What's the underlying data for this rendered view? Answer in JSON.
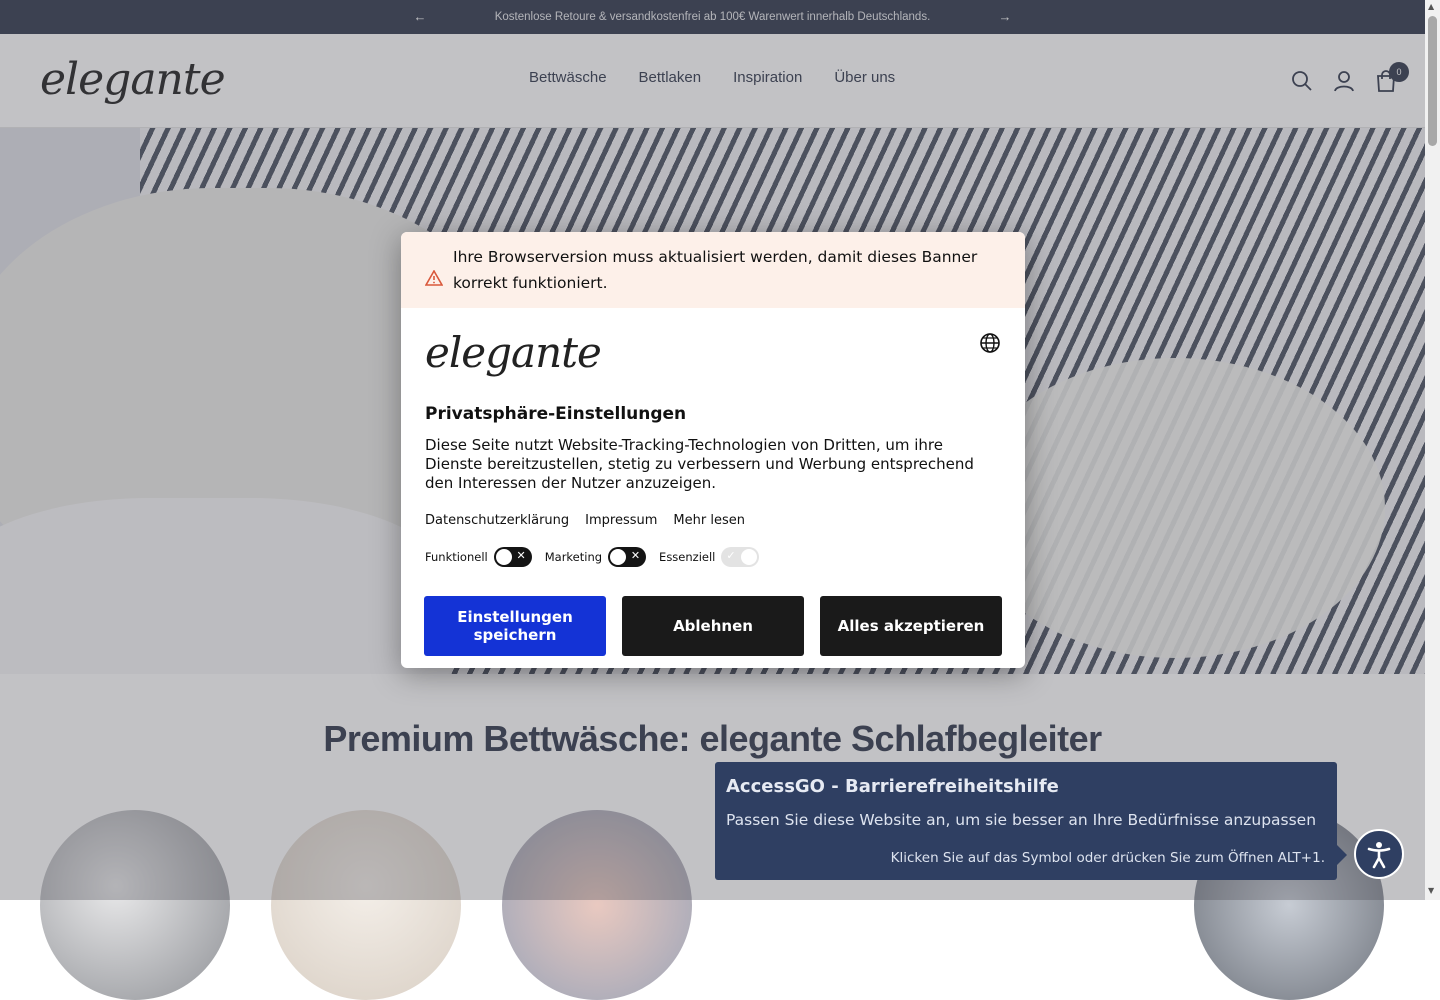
{
  "announcement": {
    "text": "Kostenlose Retoure & versandkostenfrei ab 100€ Warenwert innerhalb Deutschlands.",
    "prev_icon": "←",
    "next_icon": "→"
  },
  "header": {
    "logo": "elegante",
    "nav": [
      "Bettwäsche",
      "Bettlaken",
      "Inspiration",
      "Über uns"
    ],
    "cart_count": "0"
  },
  "section": {
    "title": "Premium Bettwäsche: elegante Schlafbegleiter"
  },
  "consent": {
    "warning": "Ihre Browserversion muss aktualisiert werden, damit dieses Banner korrekt funktioniert.",
    "logo": "elegante",
    "title": "Privatsphäre-Einstellungen",
    "description": "Diese Seite nutzt Website-Tracking-Technologien von Dritten, um ihre Dienste bereitzustellen, stetig zu verbessern und Werbung entsprechend den Interessen der Nutzer anzuzeigen.",
    "links": [
      "Datenschutzerklärung",
      "Impressum",
      "Mehr lesen"
    ],
    "toggles": [
      {
        "label": "Funktionell",
        "state": "off"
      },
      {
        "label": "Marketing",
        "state": "off"
      },
      {
        "label": "Essenziell",
        "state": "on-disabled"
      }
    ],
    "buttons": {
      "save": "Einstellungen speichern",
      "decline": "Ablehnen",
      "accept": "Alles akzeptieren"
    },
    "colors": {
      "save": "#1433d6",
      "dark": "#1a1a1a",
      "warning_bg": "#fdf0e9"
    }
  },
  "accessgo": {
    "title": "AccessGO - Barrierefreiheitshilfe",
    "subtitle": "Passen Sie diese Website an, um sie besser an Ihre Bedürfnisse anzupassen",
    "hint": "Klicken Sie auf das Symbol oder drücken Sie zum Öffnen ALT+1.",
    "color": "#2f3f62"
  }
}
